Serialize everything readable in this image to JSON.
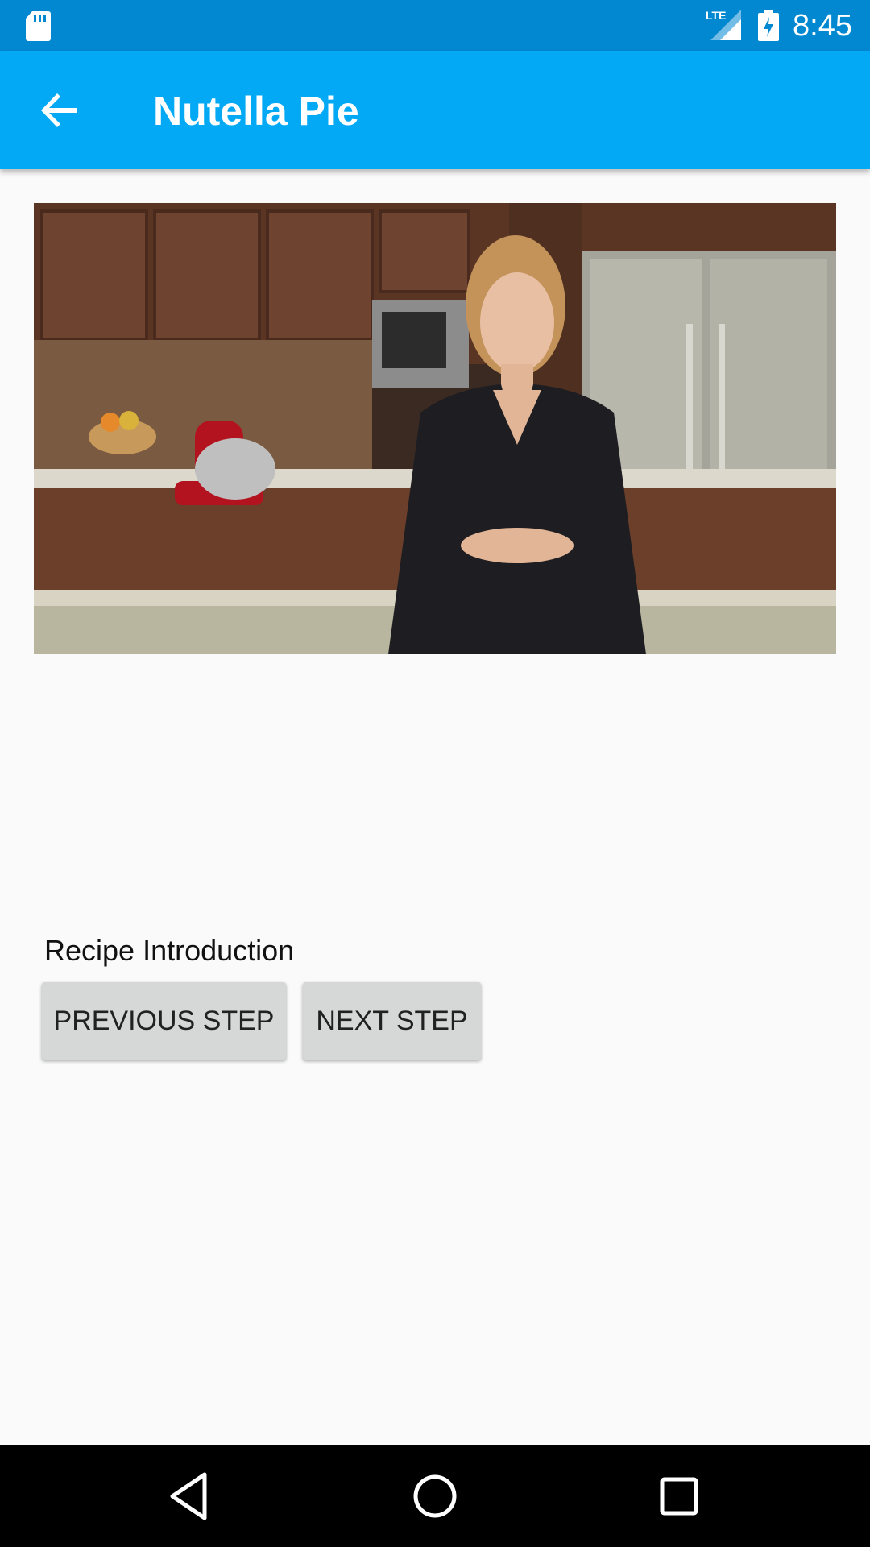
{
  "status_bar": {
    "time": "8:45",
    "network": "LTE",
    "icons": [
      "sd-card-icon",
      "lte-signal-icon",
      "battery-charging-icon"
    ]
  },
  "app_bar": {
    "title": "Nutella Pie",
    "back_icon": "arrow-back-icon"
  },
  "video": {
    "content": "video-player-frame"
  },
  "step": {
    "description": "Recipe Introduction"
  },
  "buttons": {
    "previous": "PREVIOUS STEP",
    "next": "NEXT STEP"
  },
  "nav_bar": {
    "icons": [
      "nav-back-icon",
      "nav-home-icon",
      "nav-recents-icon"
    ]
  },
  "colors": {
    "status_bar": "#0288d1",
    "app_bar": "#03a9f4",
    "background": "#fafafa",
    "button": "#d6d7d7",
    "nav_bar": "#000000"
  }
}
